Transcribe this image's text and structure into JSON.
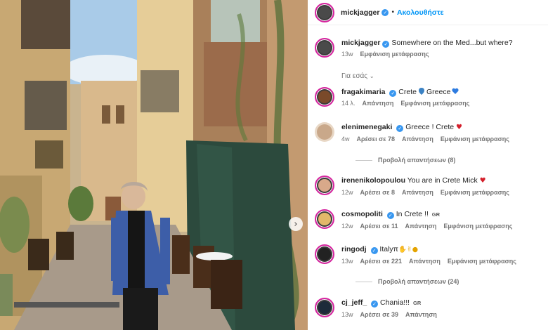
{
  "header": {
    "username": "mickjagger",
    "follow_label": "Ακολουθήστε",
    "separator": "•"
  },
  "caption": {
    "username": "mickjagger",
    "text": "Somewhere on the Med...but where?",
    "time": "13w",
    "translate": "Εμφάνιση μετάφρασης"
  },
  "filter": {
    "label": "Για εσάς",
    "icon": "chevron-down-icon"
  },
  "comments": [
    {
      "username": "fragakimaria",
      "parts": [
        "Crete",
        "Greece"
      ],
      "time": "14 λ.",
      "likes": "",
      "reply": "Απάντηση",
      "translate": "Εμφάνιση μετάφρασης"
    },
    {
      "username": "elenimenegaki",
      "text": "Greece ! Crete",
      "time": "4w",
      "likes": "Αρέσει σε 78",
      "reply": "Απάντηση",
      "translate": "Εμφάνιση μετάφρασης",
      "replies": "Προβολή απαντήσεων (8)"
    },
    {
      "username": "irenenikolopoulou",
      "text": "You are in Crete Mick",
      "time": "12w",
      "likes": "Αρέσει σε 8",
      "reply": "Απάντηση",
      "translate": "Εμφάνιση μετάφρασης"
    },
    {
      "username": "cosmopoliti",
      "text": "In Crete !!",
      "badge": "GR",
      "time": "12w",
      "likes": "Αρέσει σε 11",
      "reply": "Απάντηση",
      "translate": "Εμφάνιση μετάφρασης"
    },
    {
      "username": "ringodj",
      "text": "Italyπ",
      "time": "13w",
      "likes": "Αρέσει σε 221",
      "reply": "Απάντηση",
      "translate": "Εμφάνιση μετάφρασης",
      "replies": "Προβολή απαντήσεων (24)"
    },
    {
      "username": "cj_jeff_",
      "text": "Chania!!!",
      "badge": "GR",
      "time": "13w",
      "likes": "Αρέσει σε 39",
      "reply": "Απάντηση"
    }
  ],
  "colors": {
    "accent": "#0095f6",
    "verified": "#3897f0",
    "heart": "#d41f2b",
    "muted": "#737373"
  }
}
